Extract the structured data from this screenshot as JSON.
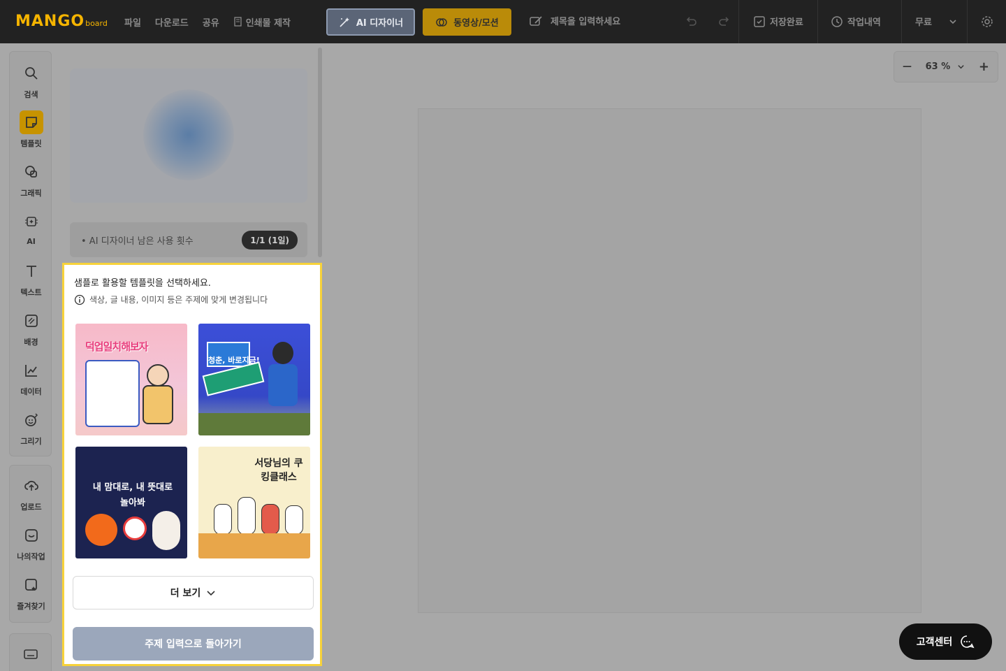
{
  "header": {
    "logo_main": "MANGO",
    "logo_sub": "board",
    "menu": [
      "파일",
      "다운로드",
      "공유",
      "인쇄물 제작"
    ],
    "ai_designer": "AI 디자이너",
    "video_motion": "동영상/모션",
    "title_placeholder": "제목을 입력하세요",
    "save_status": "저장완료",
    "history": "작업내역",
    "plan": "무료"
  },
  "leftnav": {
    "items": [
      "검색",
      "템플릿",
      "그래픽",
      "AI",
      "텍스트",
      "배경",
      "데이터",
      "그리기"
    ],
    "items2": [
      "업로드",
      "나의작업",
      "즐겨찾기"
    ]
  },
  "panel": {
    "usage_label": "• AI 디자이너 남은 사용 횟수",
    "usage_count": "1/1 (1일)"
  },
  "card": {
    "heading": "샘플로 활용할 템플릿을 선택하세요.",
    "note": "색상, 글 내용, 이미지 등은 주제에 맞게 변경됩니다",
    "templates": [
      {
        "title": "덕업일치해보자"
      },
      {
        "title": "청춘, 바로지금!"
      },
      {
        "title": "내 맘대로, 내 뜻대로 놀아봐"
      },
      {
        "title": "서당님의 쿠킹클래스"
      }
    ],
    "more_label": "더 보기",
    "back_label": "주제 입력으로 돌아가기"
  },
  "canvas": {
    "zoom": "63 %"
  },
  "help": {
    "label": "고객센터"
  }
}
